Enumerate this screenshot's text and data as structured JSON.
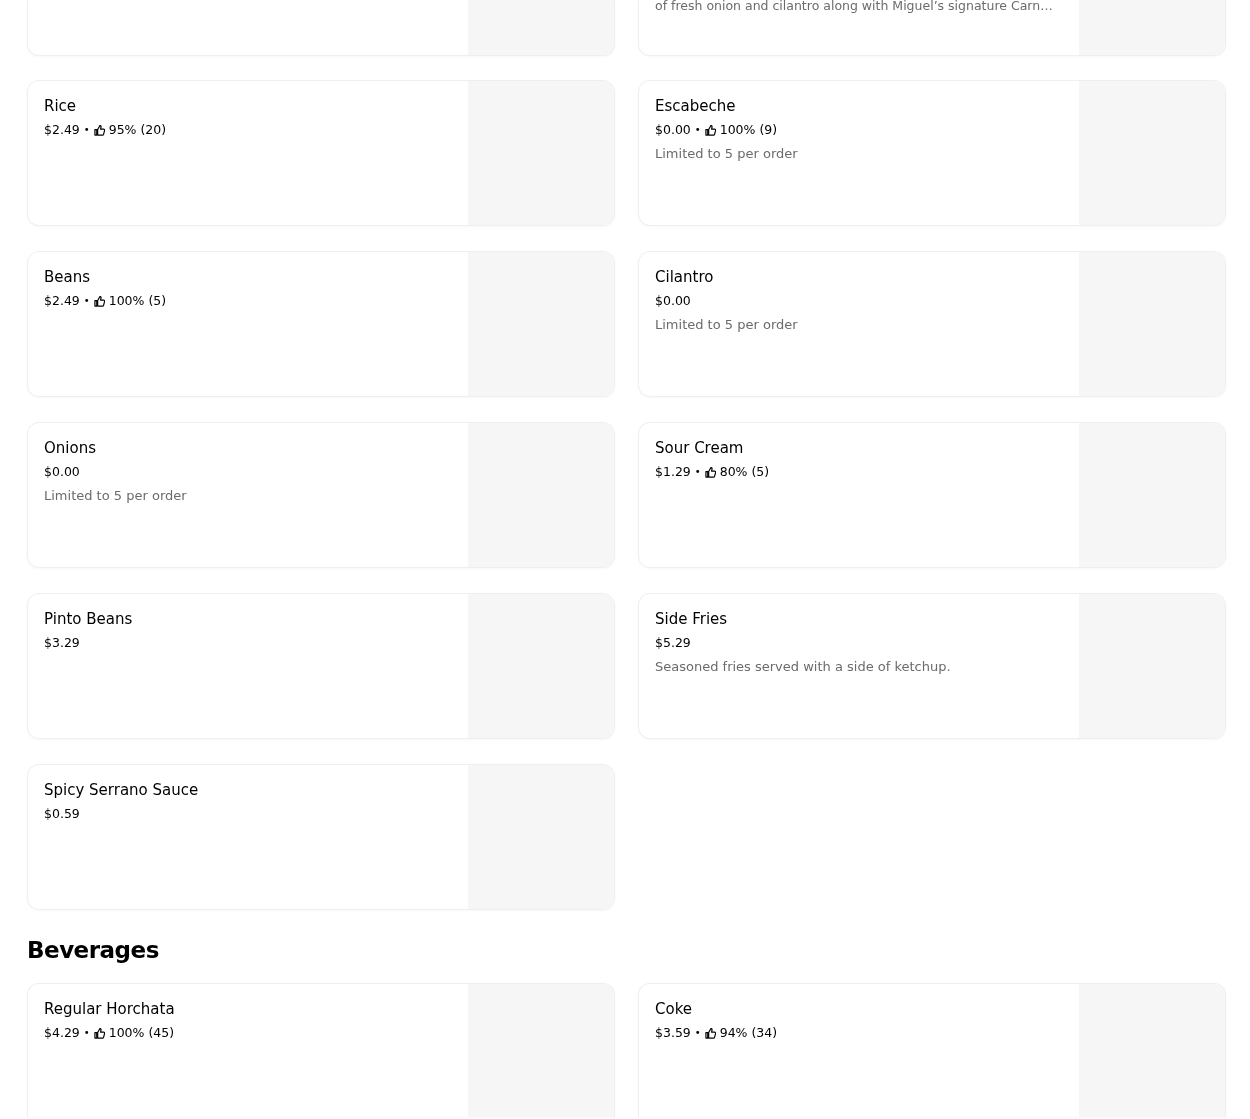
{
  "partial_row": [
    {
      "kind": "blank"
    },
    {
      "kind": "text",
      "description": "of fresh onion and cilantro along with Miguel’s signature Carn…"
    }
  ],
  "sections": [
    {
      "items": [
        {
          "name": "Rice",
          "price": "$2.49",
          "separator": "•",
          "rating": "95% (20)"
        },
        {
          "name": "Escabeche",
          "price": "$0.00",
          "separator": "•",
          "rating": "100% (9)",
          "description": "Limited to 5 per order"
        },
        {
          "name": "Beans",
          "price": "$2.49",
          "separator": "•",
          "rating": "100% (5)"
        },
        {
          "name": "Cilantro",
          "price": "$0.00",
          "description": "Limited to 5 per order"
        },
        {
          "name": "Onions",
          "price": "$0.00",
          "description": "Limited to 5 per order"
        },
        {
          "name": "Sour Cream",
          "price": "$1.29",
          "separator": "•",
          "rating": "80% (5)"
        },
        {
          "name": "Pinto Beans",
          "price": "$3.29"
        },
        {
          "name": "Side Fries",
          "price": "$5.29",
          "description": "Seasoned fries served with a side of ketchup."
        },
        {
          "name": "Spicy Serrano Sauce",
          "price": "$0.59"
        }
      ]
    },
    {
      "heading": "Beverages",
      "items": [
        {
          "name": "Regular Horchata",
          "price": "$4.29",
          "separator": "•",
          "rating": "100% (45)"
        },
        {
          "name": "Coke",
          "price": "$3.59",
          "separator": "•",
          "rating": "94% (34)"
        }
      ]
    }
  ]
}
